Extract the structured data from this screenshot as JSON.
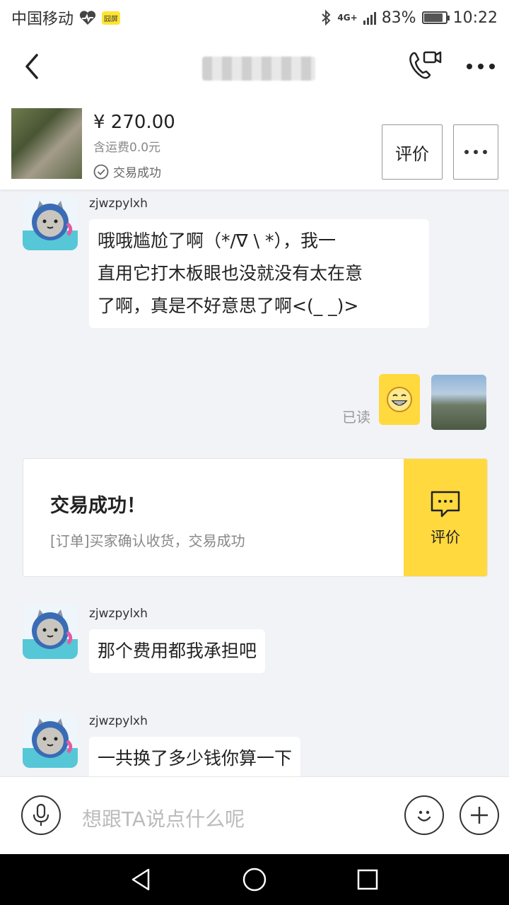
{
  "status_bar": {
    "carrier": "中国移动",
    "badge": "囧屏",
    "network": "4G+",
    "battery": "83%",
    "time": "10:22"
  },
  "product": {
    "price": "¥ 270.00",
    "shipping": "含运费0.0元",
    "status": "交易成功",
    "rate_button": "评价"
  },
  "messages": [
    {
      "sender": "zjwzpylxh",
      "lines": [
        "哦哦尴尬了啊（*/∇ \\ *），我一",
        "直用它打木板眼也没就没有太在意",
        "了啊，真是不好意思了啊<(_ _)>"
      ]
    },
    {
      "sender": "zjwzpylxh",
      "text": "那个费用都我承担吧"
    },
    {
      "sender": "zjwzpylxh",
      "text": "一共换了多少钱你算一下"
    }
  ],
  "my_message": {
    "read_status": "已读",
    "sticker": "grin-emoji"
  },
  "system_card": {
    "title": "交易成功！",
    "description": "[订单]买家确认收货，交易成功",
    "button": "评价"
  },
  "input": {
    "placeholder": "想跟TA说点什么呢"
  },
  "colors": {
    "accent": "#ffd93e",
    "background": "#f1f3f7"
  }
}
